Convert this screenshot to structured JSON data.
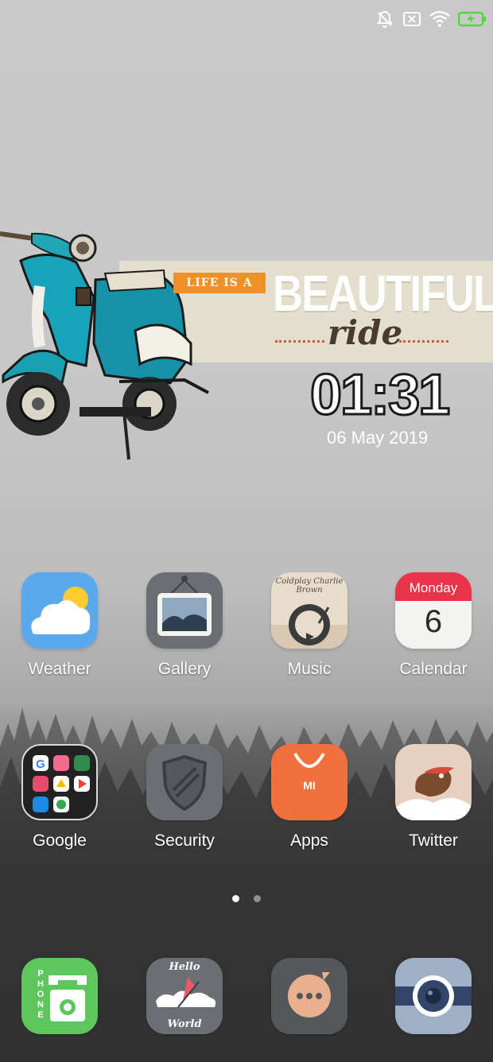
{
  "status_bar": {
    "icons": [
      "mute-icon",
      "sim-off-icon",
      "wifi-icon",
      "battery-charging-icon"
    ],
    "battery_color": "#5ad24a"
  },
  "widget": {
    "tag": "LIFE IS A",
    "headline": "BEAUTIFUL",
    "script": "ride",
    "time": "01:31",
    "date": "06 May 2019"
  },
  "home_row1": [
    {
      "label": "Weather",
      "icon": "weather-icon"
    },
    {
      "label": "Gallery",
      "icon": "gallery-icon"
    },
    {
      "label": "Music",
      "icon": "music-icon",
      "art_text": "Coldplay Charlie Brown"
    },
    {
      "label": "Calendar",
      "icon": "calendar-icon",
      "day_name": "Monday",
      "day_number": "6"
    }
  ],
  "home_row2": [
    {
      "label": "Google",
      "icon": "google-folder-icon"
    },
    {
      "label": "Security",
      "icon": "security-shield-icon"
    },
    {
      "label": "Apps",
      "icon": "mi-apps-icon",
      "brand": "MI"
    },
    {
      "label": "Twitter",
      "icon": "twitter-bird-icon"
    }
  ],
  "pager": {
    "pages": 2,
    "active": 1
  },
  "dock": [
    {
      "icon": "phone-icon",
      "text": "PHONE"
    },
    {
      "icon": "browser-icon",
      "top_text": "Hello",
      "bottom_text": "World"
    },
    {
      "icon": "messaging-icon"
    },
    {
      "icon": "camera-icon"
    }
  ],
  "colors": {
    "weather_bg": "#5aa9ee",
    "music_bg": "#e8dccb",
    "calendar_header": "#e8334a",
    "apps_bg": "#f2703d",
    "phone_bg": "#5fc65d",
    "camera_bg": "#9fb0c6"
  }
}
